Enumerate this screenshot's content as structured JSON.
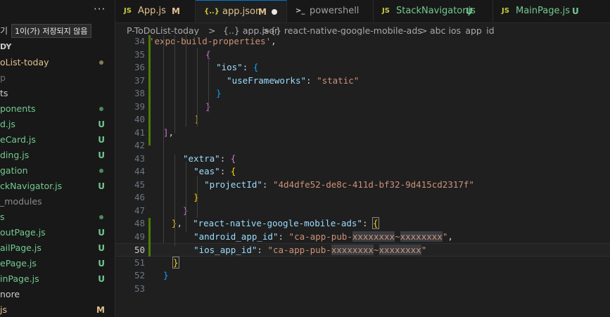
{
  "sidebar": {
    "more_label": "···",
    "tooltip_prefix": "기",
    "tooltip": "1이(가) 저장되지 않음",
    "items": [
      {
        "label": "DY",
        "color": "#cccccc",
        "bold": true
      },
      {
        "label": "oList-today",
        "color": "#e2c08d",
        "dot": "#8a7a5a"
      },
      {
        "label": "p",
        "color": "#6e6e6e"
      },
      {
        "label": "ts",
        "color": "#cccccc"
      },
      {
        "label": "ponents",
        "color": "#73c991",
        "dot": "#4c8a5c"
      },
      {
        "label": "d.js",
        "color": "#73c991",
        "status": "U",
        "status_color": "#73c991"
      },
      {
        "label": "eCard.js",
        "color": "#73c991",
        "status": "U",
        "status_color": "#73c991"
      },
      {
        "label": "ding.js",
        "color": "#73c991",
        "status": "U",
        "status_color": "#73c991"
      },
      {
        "label": "gation",
        "color": "#73c991",
        "dot": "#4c8a5c"
      },
      {
        "label": "ckNavigator.js",
        "color": "#73c991",
        "status": "U",
        "status_color": "#73c991"
      },
      {
        "label": "_modules",
        "color": "#8b8b8b"
      },
      {
        "label": "s",
        "color": "#73c991",
        "dot": "#4c8a5c"
      },
      {
        "label": "outPage.js",
        "color": "#73c991",
        "status": "U",
        "status_color": "#73c991"
      },
      {
        "label": "ailPage.js",
        "color": "#73c991",
        "status": "U",
        "status_color": "#73c991"
      },
      {
        "label": "ePage.js",
        "color": "#73c991",
        "status": "U",
        "status_color": "#73c991"
      },
      {
        "label": "inPage.js",
        "color": "#73c991",
        "status": "U",
        "status_color": "#73c991"
      },
      {
        "label": "nore",
        "color": "#cccccc"
      },
      {
        "label": "js",
        "color": "#e2c08d",
        "status": "M",
        "status_color": "#e2c08d"
      }
    ]
  },
  "tabs": [
    {
      "icon": "JS",
      "icon_color": "#cbcb41",
      "label": "App.js",
      "label_color": "#e2c08d",
      "status": "M",
      "status_color": "#e2c08d"
    },
    {
      "icon": "{..}",
      "icon_color": "#cbcb41",
      "label": "app.json",
      "label_color": "#e2c08d",
      "status": "M",
      "status_color": "#e2c08d",
      "active": true,
      "dirty": true
    },
    {
      "icon": ">_",
      "icon_color": "#cccccc",
      "label": "powershell",
      "label_color": "#a0a0a0"
    },
    {
      "icon": "JS",
      "icon_color": "#cbcb41",
      "label": "StackNavigator.js",
      "label_color": "#73c991",
      "status": "U",
      "status_color": "#73c991"
    },
    {
      "icon": "JS",
      "icon_color": "#cbcb41",
      "label": "MainPage.js",
      "label_color": "#73c991",
      "status": "U",
      "status_color": "#73c991"
    }
  ],
  "breadcrumb": [
    "P-ToDoList-today",
    ">",
    "{..} app.json",
    ">",
    "{} react-native-google-mobile-ads",
    ">",
    "abc ios_app_id"
  ],
  "editor": {
    "current_line": 50,
    "lines": [
      {
        "n": "34",
        "html": "<span class=\"s\">'expo-build-properties'</span><span class=\"p\">,</span>"
      },
      {
        "n": "35",
        "html": "<span class=\"b2\">{</span>"
      },
      {
        "n": "36",
        "html": "  <span class=\"k\">\"ios\"</span><span class=\"p\">: </span><span class=\"b3\">{</span>"
      },
      {
        "n": "37",
        "html": "    <span class=\"k\">\"useFrameworks\"</span><span class=\"p\">: </span><span class=\"s\">\"static\"</span>"
      },
      {
        "n": "38",
        "html": "  <span class=\"b3\">}</span>"
      },
      {
        "n": "39",
        "html": "<span class=\"b2\">}</span>"
      },
      {
        "n": "40",
        "html": "<span class=\"b1\">]</span>"
      },
      {
        "n": "41",
        "html": "<span class=\"b2\">]</span><span class=\"p\">,</span>"
      },
      {
        "n": "42",
        "html": ""
      },
      {
        "n": "43",
        "html": "<span class=\"k\">\"extra\"</span><span class=\"p\">: </span><span class=\"b2\">{</span>"
      },
      {
        "n": "44",
        "html": "  <span class=\"k\">\"eas\"</span><span class=\"p\">: </span><span class=\"b1\">{</span>"
      },
      {
        "n": "45",
        "html": "    <span class=\"k\">\"projectId\"</span><span class=\"p\">: </span><span class=\"s\">\"4d4dfe52-de8c-411d-bf32-9d415cd2317f\"</span>"
      },
      {
        "n": "46",
        "html": "  <span class=\"b1\">}</span>"
      },
      {
        "n": "47",
        "html": "<span class=\"b2\">}</span>"
      },
      {
        "n": "48",
        "html": "<span class=\"b1\">}</span><span class=\"p\">,  </span><span class=\"k\">\"react-native-google-mobile-ads\"</span><span class=\"p\">: </span><span class=\"b1\" style=\"outline:1px solid #888;\">{</span>"
      },
      {
        "n": "49",
        "html": "  <span class=\"k\">\"android_app_id\"</span><span class=\"p\">: </span><span class=\"s\">\"ca-app-pub-<span class=\"hl\">xxxxxxxx</span>~<span class=\"hl\">xxxxxxxx</span>\"</span><span class=\"p\">,</span>"
      },
      {
        "n": "50",
        "html": "  <span class=\"k\">\"ios_app_id\"</span><span class=\"p\">: </span><span class=\"s\">\"ca-app-pub-<span class=\"hl\">xxxxxxxx</span>~<span class=\"hl\">xxxxxxxx</span>\"</span>"
      },
      {
        "n": "51",
        "html": "<span class=\"b1\" style=\"outline:1px solid #888;\">}</span>"
      },
      {
        "n": "52",
        "html": "<span class=\"b3\">}</span>"
      },
      {
        "n": "53",
        "html": ""
      }
    ]
  }
}
